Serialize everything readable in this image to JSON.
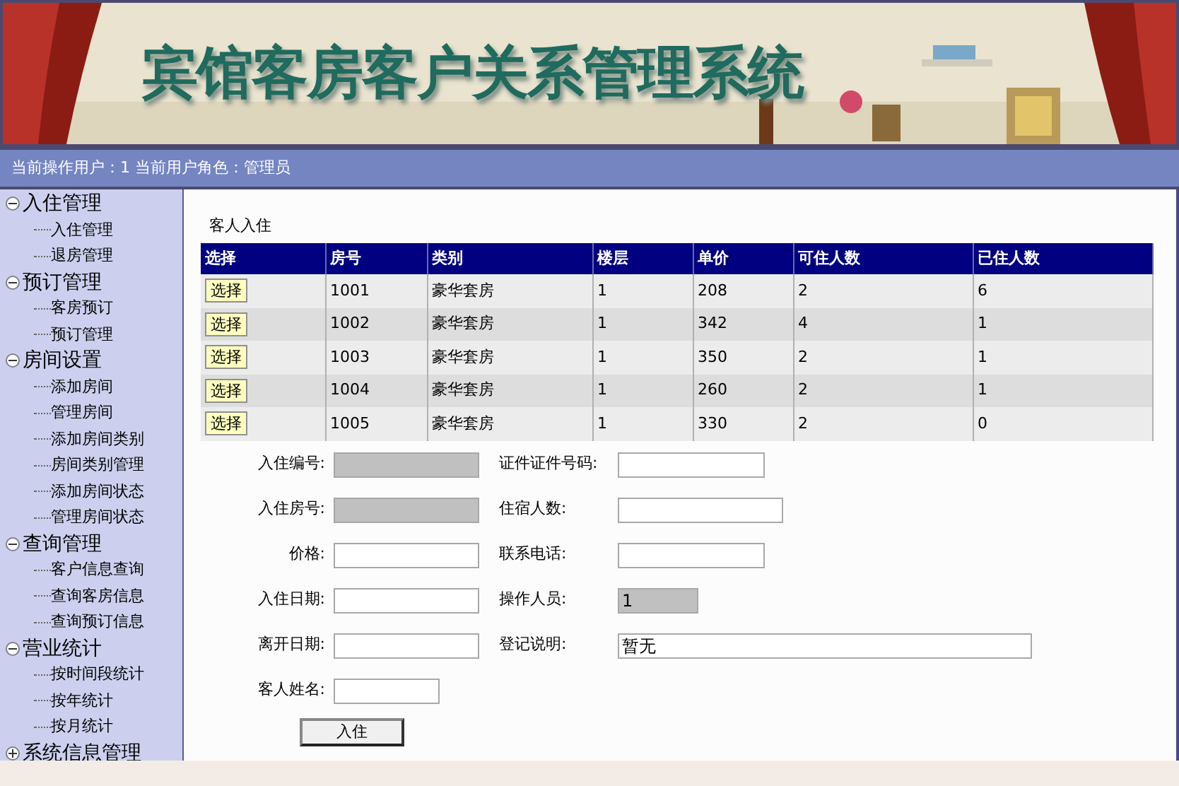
{
  "header": {
    "title": "宾馆客房客户关系管理系统"
  },
  "user_bar": {
    "text": "当前操作用户：1 当前用户角色：管理员"
  },
  "sidebar": {
    "items": [
      {
        "label": "入住管理",
        "expanded": true,
        "children": [
          {
            "label": "入住管理"
          },
          {
            "label": "退房管理"
          }
        ]
      },
      {
        "label": "预订管理",
        "expanded": true,
        "children": [
          {
            "label": "客房预订"
          },
          {
            "label": "预订管理"
          }
        ]
      },
      {
        "label": "房间设置",
        "expanded": true,
        "children": [
          {
            "label": "添加房间"
          },
          {
            "label": "管理房间"
          },
          {
            "label": "添加房间类别"
          },
          {
            "label": "房间类别管理"
          },
          {
            "label": "添加房间状态"
          },
          {
            "label": "管理房间状态"
          }
        ]
      },
      {
        "label": "查询管理",
        "expanded": true,
        "children": [
          {
            "label": "客户信息查询"
          },
          {
            "label": "查询客房信息"
          },
          {
            "label": "查询预订信息"
          }
        ]
      },
      {
        "label": "营业统计",
        "expanded": true,
        "children": [
          {
            "label": "按时间段统计"
          },
          {
            "label": "按年统计"
          },
          {
            "label": "按月统计"
          }
        ]
      },
      {
        "label": "系统信息管理",
        "expanded": false
      }
    ]
  },
  "page": {
    "title": "客人入住"
  },
  "table": {
    "columns": [
      "选择",
      "房号",
      "类别",
      "楼层",
      "单价",
      "可住人数",
      "已住人数"
    ],
    "rows": [
      {
        "cells": [
          "选择",
          "1001",
          "豪华套房",
          "1",
          "208",
          "2",
          "6"
        ]
      },
      {
        "cells": [
          "选择",
          "1002",
          "豪华套房",
          "1",
          "342",
          "4",
          "1"
        ]
      },
      {
        "cells": [
          "选择",
          "1003",
          "豪华套房",
          "1",
          "350",
          "2",
          "1"
        ]
      },
      {
        "cells": [
          "选择",
          "1004",
          "豪华套房",
          "1",
          "260",
          "2",
          "1"
        ]
      },
      {
        "cells": [
          "选择",
          "1005",
          "豪华套房",
          "1",
          "330",
          "2",
          "0"
        ]
      }
    ]
  },
  "form": {
    "left": [
      {
        "label": "入住编号:",
        "disabled": true
      },
      {
        "label": "入住房号:",
        "disabled": true
      },
      {
        "label": "价格:",
        "disabled": false
      },
      {
        "label": "入住日期:",
        "disabled": false
      },
      {
        "label": "离开日期:",
        "disabled": false
      },
      {
        "label": "客人姓名:",
        "disabled": false
      }
    ],
    "right": [
      {
        "label": "证件证件号码:",
        "disabled": false
      },
      {
        "label": "住宿人数:",
        "disabled": false
      },
      {
        "label": "联系电话:",
        "disabled": false
      },
      {
        "label": "操作人员:",
        "disabled": true,
        "value": "1"
      },
      {
        "label": "登记说明:",
        "disabled": false,
        "value": "暂无"
      }
    ],
    "submit": "入住"
  }
}
